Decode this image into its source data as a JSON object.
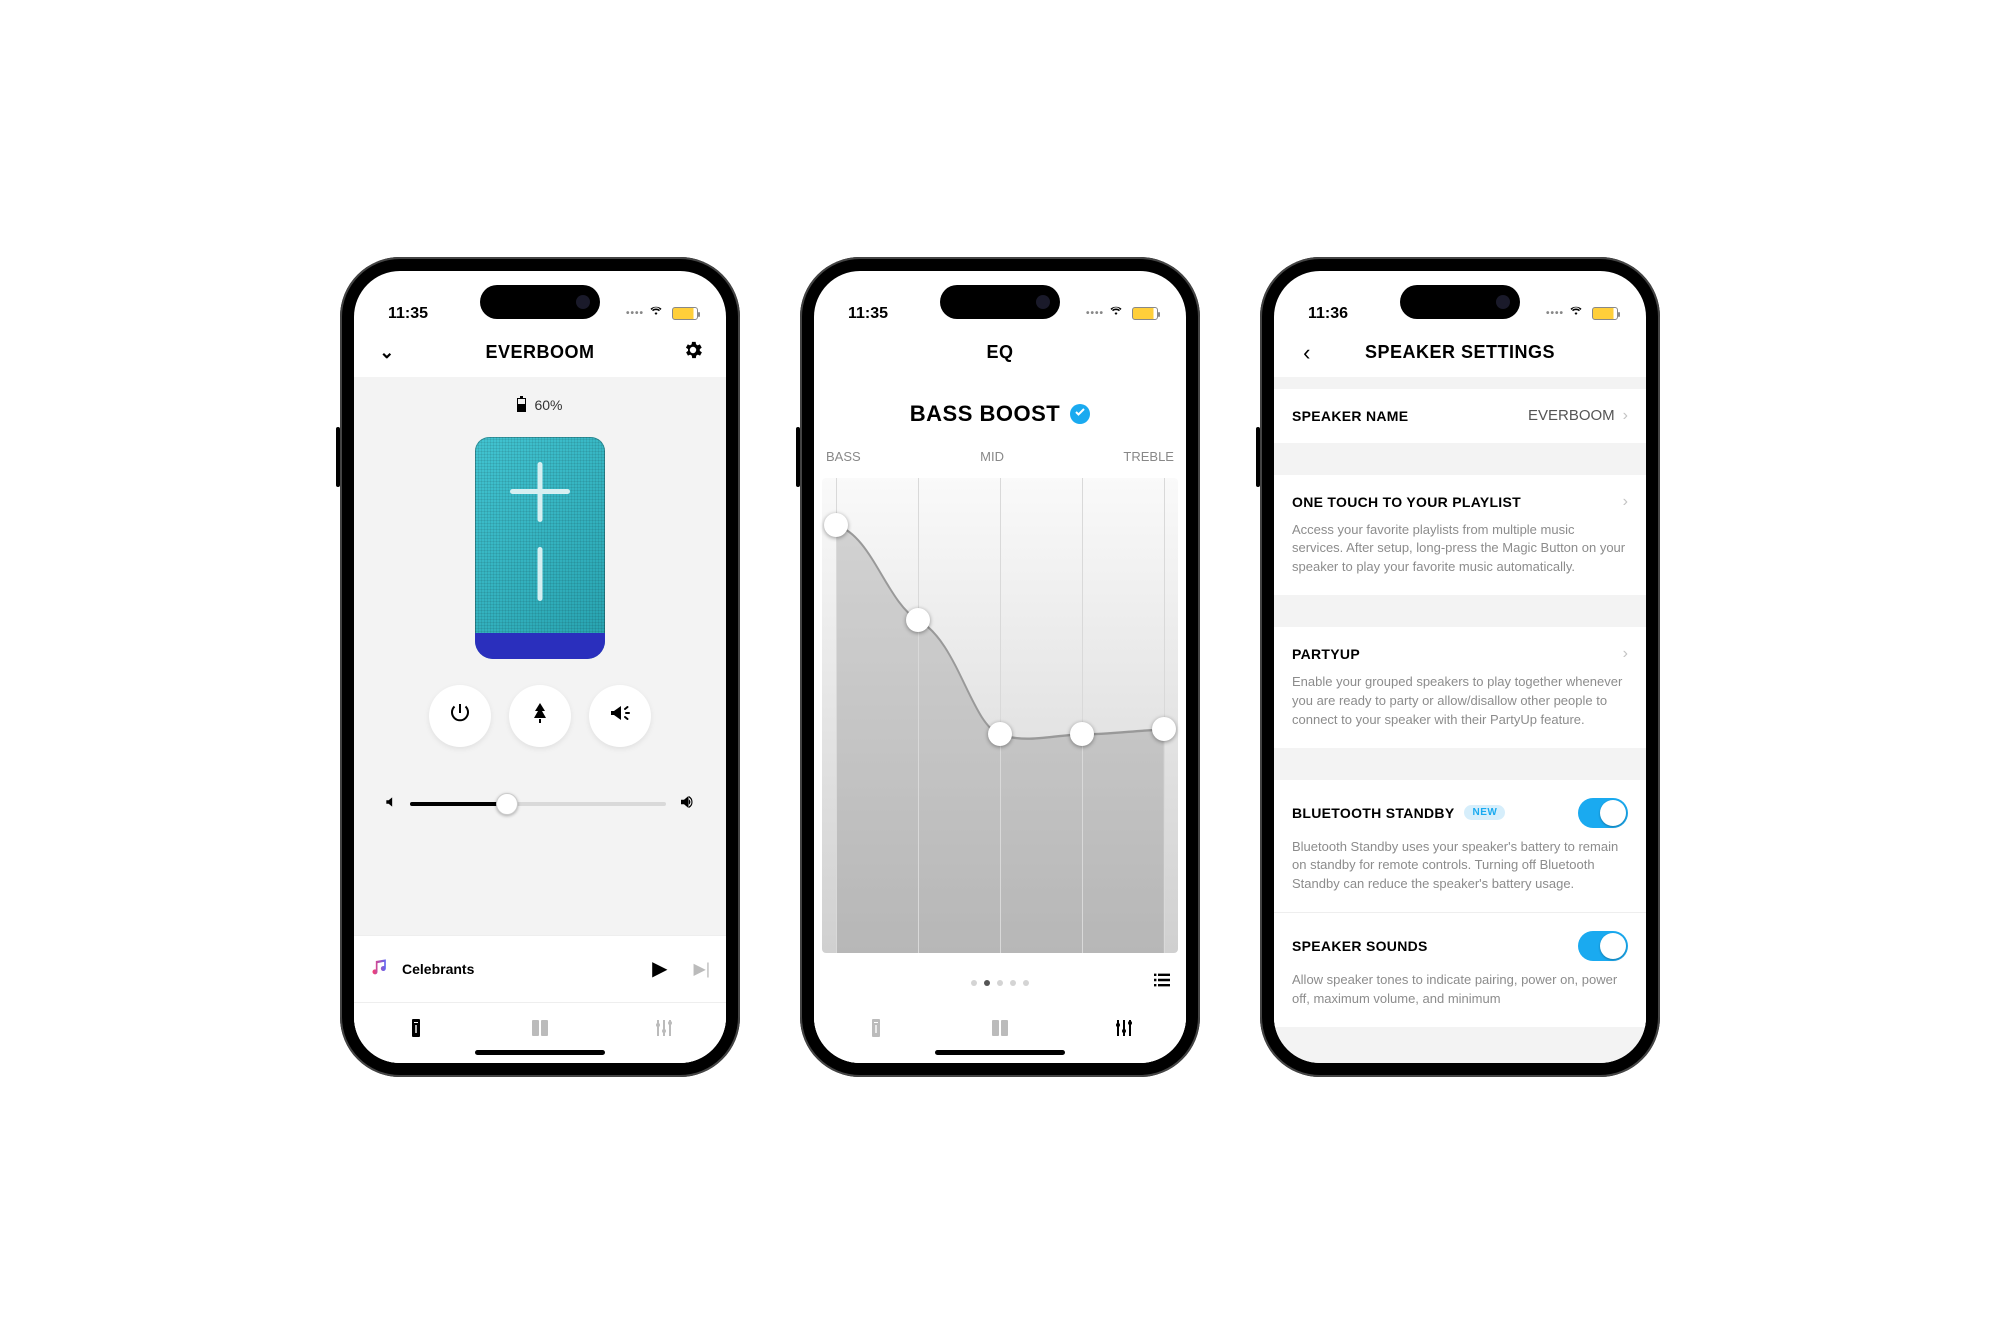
{
  "status": {
    "time_a": "11:35",
    "time_b": "11:35",
    "time_c": "11:36"
  },
  "screen1": {
    "title": "EVERBOOM",
    "battery_pct": "60%",
    "now_playing": "Celebrants",
    "volume_pct": 38
  },
  "screen2": {
    "header": "EQ",
    "preset": "BASS BOOST",
    "bands": {
      "bass": "BASS",
      "mid": "MID",
      "treble": "TREBLE"
    }
  },
  "screen3": {
    "title": "SPEAKER SETTINGS",
    "speaker_name_label": "SPEAKER NAME",
    "speaker_name_value": "EVERBOOM",
    "playlist_label": "ONE TOUCH TO YOUR PLAYLIST",
    "playlist_desc": "Access your favorite playlists from multiple music services. After setup, long-press the Magic Button on your speaker to play your favorite music automatically.",
    "partyup_label": "PARTYUP",
    "partyup_desc": "Enable your grouped speakers to play together whenever you are ready to party or allow/disallow other people to connect to your speaker with their PartyUp feature.",
    "bt_label": "BLUETOOTH STANDBY",
    "bt_badge": "NEW",
    "bt_desc": "Bluetooth Standby uses your speaker's battery to remain on standby for remote controls. Turning off Bluetooth Standby can reduce the speaker's battery usage.",
    "sounds_label": "SPEAKER SOUNDS",
    "sounds_desc": "Allow speaker tones to indicate pairing, power on, power off, maximum volume, and minimum"
  },
  "chart_data": {
    "type": "line",
    "title": "BASS BOOST",
    "x_labels": [
      "BASS",
      "",
      "MID",
      "",
      "TREBLE"
    ],
    "values_pct_from_top": [
      10,
      30,
      54,
      54,
      53
    ],
    "page_index": 1,
    "page_count": 5
  }
}
